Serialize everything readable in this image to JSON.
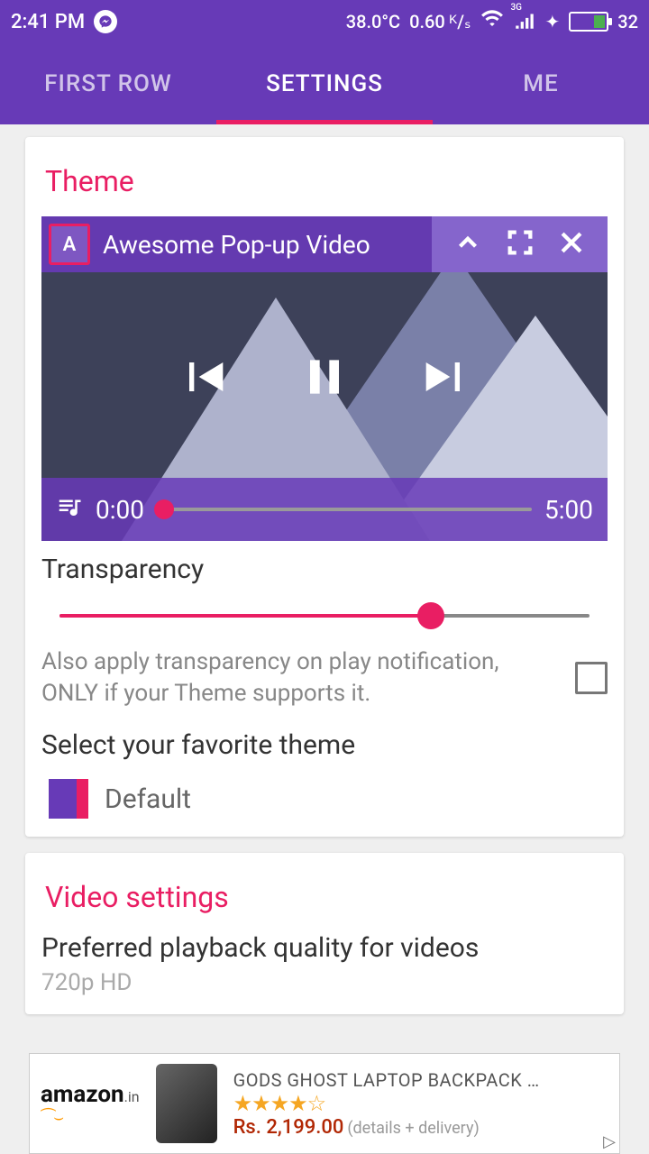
{
  "status": {
    "time": "2:41 PM",
    "temp": "38.0°C",
    "speed": "0.60 ᴷ/ₛ",
    "net_label": "3G",
    "battery": "32"
  },
  "tabs": {
    "first": "FIRST ROW",
    "settings": "SETTINGS",
    "me": "ME"
  },
  "theme": {
    "title": "Theme",
    "preview_title": "Awesome Pop-up Video",
    "preview_logo": "A",
    "time_start": "0:00",
    "time_end": "5:00",
    "transparency_label": "Transparency",
    "apply_notification_text": "Also apply transparency on play notification, ONLY if your Theme supports it.",
    "select_theme_label": "Select your favorite theme",
    "selected_theme": "Default"
  },
  "video": {
    "title": "Video settings",
    "quality_label": "Preferred playback quality for videos",
    "quality_value": "720p HD"
  },
  "ad": {
    "brand": "amazon",
    "brand_suffix": ".in",
    "product": "GODS GHOST LAPTOP BACKPACK …",
    "price": "Rs. 2,199.00",
    "detail": "(details + delivery)"
  }
}
